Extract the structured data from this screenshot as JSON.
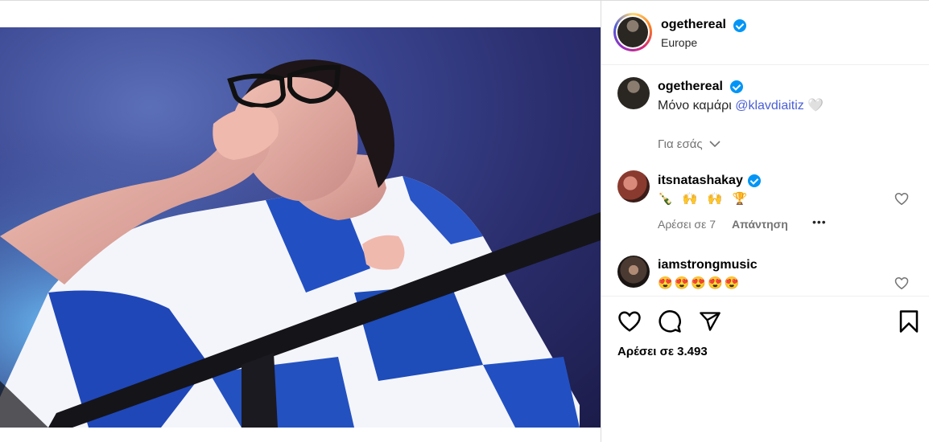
{
  "post": {
    "author": "ogethereal",
    "location": "Europe",
    "caption_prefix": "Μόνο καμάρι",
    "caption_mention": "@klavdiaitiz",
    "caption_emoji": "🤍",
    "translation_link": "Για εσάς",
    "likes_label": "Αρέσει σε 3.493"
  },
  "comments": [
    {
      "username": "itsnatashakay",
      "verified": true,
      "text": "🍾 🙌 🙌 🏆",
      "likes_label": "Αρέσει σε 7",
      "reply_label": "Απάντηση",
      "more": "•••"
    },
    {
      "username": "iamstrongmusic",
      "verified": false,
      "text": "😍😍😍😍😍"
    }
  ],
  "icons": {
    "verified": "verified-badge-icon",
    "chevron": "chevron-down-icon",
    "like": "heart-icon",
    "comment": "comment-icon",
    "share": "paper-plane-icon",
    "save": "bookmark-icon"
  },
  "colors": {
    "verified": "#0095f6",
    "mention": "#4b5fd6",
    "muted": "#737373"
  }
}
